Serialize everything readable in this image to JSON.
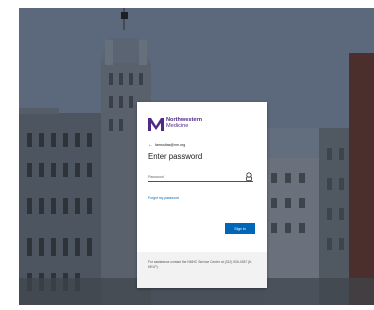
{
  "brand": {
    "line1": "Northwestern",
    "line2": "Medicine",
    "color": "#4e2a84"
  },
  "back": {
    "icon": "arrow-left-icon",
    "account": "famsotias@nm.org"
  },
  "title": "Enter password",
  "password": {
    "placeholder": "Password",
    "value": "",
    "icon": "key-icon"
  },
  "forgot_link": "Forgot my password",
  "signin_button": "Sign in",
  "assist_text": "For assistance contact the NMHC Service Center at (312) 926-4357 (6-HELP).",
  "colors": {
    "accent": "#0067b8",
    "background_overlay": "#5b6779"
  }
}
